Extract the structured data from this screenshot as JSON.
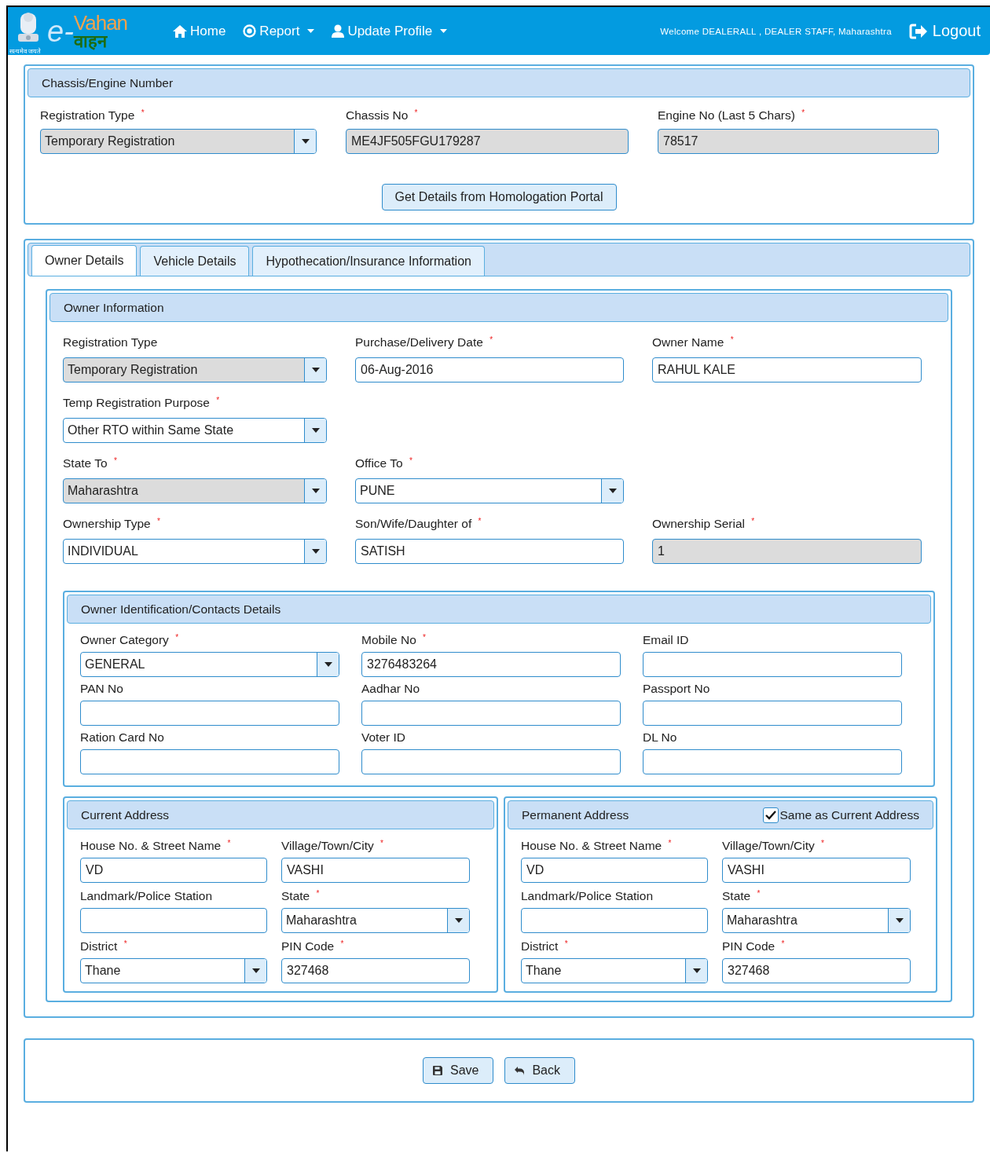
{
  "header": {
    "logo": {
      "prefix": "e-",
      "name": "Vahan",
      "hindi": "वाहन",
      "motto": "सत्यमेव जयते"
    },
    "nav": [
      {
        "label": "Home",
        "dropdown": false
      },
      {
        "label": "Report",
        "dropdown": true
      },
      {
        "label": "Update Profile",
        "dropdown": true
      }
    ],
    "welcome": "Welcome DEALERALL , DEALER STAFF, Maharashtra",
    "logout": "Logout"
  },
  "chassis_panel": {
    "title": "Chassis/Engine Number",
    "fields": [
      {
        "label": "Registration Type",
        "required_mark": "*",
        "kind": "select",
        "value": "Temporary Registration",
        "disabled": true
      },
      {
        "label": "Chassis No",
        "required_mark": "*",
        "kind": "text",
        "value": "ME4JF505FGU179287",
        "disabled": true
      },
      {
        "label": "Engine No (Last 5 Chars)",
        "required_mark": "*",
        "kind": "text",
        "value": "78517",
        "disabled": true
      }
    ],
    "button": "Get Details from Homologation Portal"
  },
  "tabs": [
    {
      "label": "Owner Details",
      "selected": true
    },
    {
      "label": "Vehicle Details",
      "selected": false
    },
    {
      "label": "Hypothecation/Insurance Information",
      "selected": false
    }
  ],
  "owner_information": {
    "title": "Owner Information",
    "rows": [
      [
        {
          "label": "Registration Type",
          "kind": "select",
          "value": "Temporary Registration",
          "disabled": true
        },
        {
          "label": "Purchase/Delivery Date",
          "required_mark": "*",
          "kind": "text",
          "value": "06-Aug-2016",
          "disabled": false
        },
        {
          "label": "Owner Name",
          "required_mark": "*",
          "kind": "text",
          "value": "RAHUL KALE",
          "disabled": false
        }
      ],
      [
        {
          "label": "Temp Registration Purpose",
          "required_mark": "*",
          "kind": "select",
          "value": "Other RTO within Same State",
          "disabled": false
        }
      ],
      [
        {
          "label": "State To",
          "required_mark": "*",
          "kind": "select",
          "value": "Maharashtra",
          "disabled": true
        },
        {
          "label": "Office To",
          "required_mark": "*",
          "kind": "select",
          "value": "PUNE",
          "disabled": false
        }
      ],
      [
        {
          "label": "Ownership Type",
          "required_mark": "*",
          "kind": "select",
          "value": "INDIVIDUAL",
          "disabled": false
        },
        {
          "label": "Son/Wife/Daughter of",
          "required_mark": "*",
          "kind": "text",
          "value": "SATISH",
          "disabled": false
        },
        {
          "label": "Ownership Serial",
          "required_mark": "*",
          "kind": "text",
          "value": "1",
          "disabled": true
        }
      ]
    ],
    "identification": {
      "title": "Owner Identification/Contacts Details",
      "fields": [
        {
          "label": "Owner Category",
          "required_mark": "*",
          "kind": "select",
          "value": "GENERAL",
          "disabled": false
        },
        {
          "label": "Mobile No",
          "required_mark": "*",
          "kind": "text",
          "value": "3276483264",
          "disabled": false
        },
        {
          "label": "Email ID",
          "kind": "text",
          "disabled": false
        },
        {
          "label": "PAN No",
          "kind": "text",
          "disabled": false
        },
        {
          "label": "Aadhar No",
          "kind": "text",
          "disabled": false
        },
        {
          "label": "Passport No",
          "kind": "text",
          "disabled": false
        },
        {
          "label": "Ration Card No",
          "kind": "text",
          "disabled": false
        },
        {
          "label": "Voter ID",
          "kind": "text",
          "disabled": false
        },
        {
          "label": "DL No",
          "kind": "text",
          "disabled": false
        }
      ]
    },
    "current_address": {
      "title": "Current Address",
      "fields": [
        {
          "label": "House No. & Street Name",
          "required_mark": "*",
          "kind": "text",
          "value": "VD",
          "disabled": false
        },
        {
          "label": "Village/Town/City",
          "required_mark": "*",
          "kind": "text",
          "value": "VASHI",
          "disabled": false
        },
        {
          "label": "Landmark/Police Station",
          "kind": "text",
          "disabled": false
        },
        {
          "label": "State",
          "required_mark": "*",
          "kind": "select",
          "value": "Maharashtra",
          "disabled": false
        },
        {
          "label": "District",
          "required_mark": "*",
          "kind": "select",
          "value": "Thane",
          "disabled": false
        },
        {
          "label": "PIN Code",
          "required_mark": "*",
          "kind": "text",
          "value": "327468",
          "disabled": false
        }
      ]
    },
    "permanent_address": {
      "title": "Permanent Address",
      "same_as_current": {
        "label": "Same as Current Address",
        "checked": true
      },
      "fields": [
        {
          "label": "House No. & Street Name",
          "required_mark": "*",
          "kind": "text",
          "value": "VD",
          "disabled": false
        },
        {
          "label": "Village/Town/City",
          "required_mark": "*",
          "kind": "text",
          "value": "VASHI",
          "disabled": false
        },
        {
          "label": "Landmark/Police Station",
          "kind": "text",
          "disabled": false
        },
        {
          "label": "State",
          "required_mark": "*",
          "kind": "select",
          "value": "Maharashtra",
          "disabled": false
        },
        {
          "label": "District",
          "required_mark": "*",
          "kind": "select",
          "value": "Thane",
          "disabled": false
        },
        {
          "label": "PIN Code",
          "required_mark": "*",
          "kind": "text",
          "value": "327468",
          "disabled": false
        }
      ]
    }
  },
  "actions": [
    {
      "label": "Save"
    },
    {
      "label": "Back"
    }
  ]
}
